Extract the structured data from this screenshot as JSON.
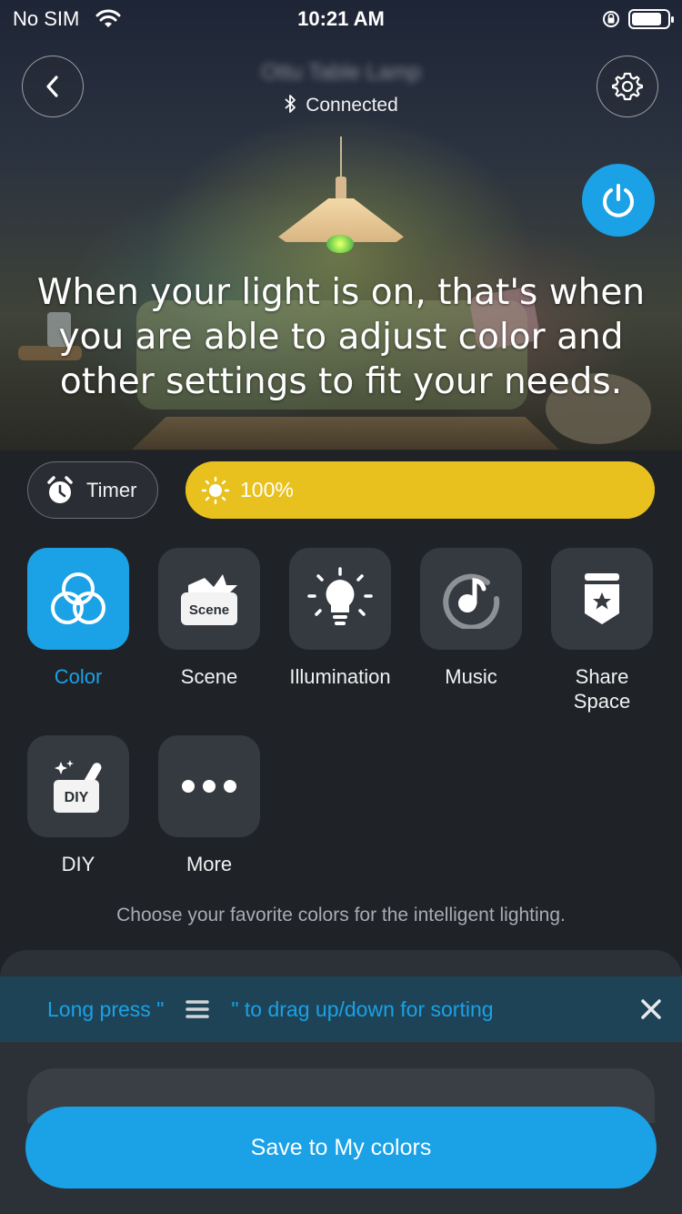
{
  "status_bar": {
    "carrier": "No SIM",
    "time": "10:21 AM"
  },
  "header": {
    "device_name": "Ottu Table Lamp",
    "connection_status": "Connected"
  },
  "hero": {
    "message": "When your light is on, that's when you are able to adjust color and other settings to fit your needs."
  },
  "controls": {
    "timer_label": "Timer",
    "brightness_label": "100%",
    "brightness_value": 1.0
  },
  "features": [
    {
      "label": "Color",
      "icon": "color-rings-icon",
      "active": true
    },
    {
      "label": "Scene",
      "icon": "scene-icon",
      "active": false
    },
    {
      "label": "Illumination",
      "icon": "bulb-icon",
      "active": false
    },
    {
      "label": "Music",
      "icon": "music-icon",
      "active": false
    },
    {
      "label": "Share Space",
      "icon": "share-space-icon",
      "active": false
    },
    {
      "label": "DIY",
      "icon": "diy-icon",
      "active": false
    },
    {
      "label": "More",
      "icon": "more-icon",
      "active": false
    }
  ],
  "scene_icon_text": "Scene",
  "diy_icon_text": "DIY",
  "hint": "Choose your favorite colors for the intelligent lighting.",
  "tip": {
    "before": "Long press \"",
    "after": "\" to drag up/down for sorting"
  },
  "save_button_label": "Save to My colors",
  "colors": {
    "accent": "#1aa1e6",
    "brightness": "#e8c11f",
    "background": "#1f2328",
    "tile": "#353a41"
  }
}
